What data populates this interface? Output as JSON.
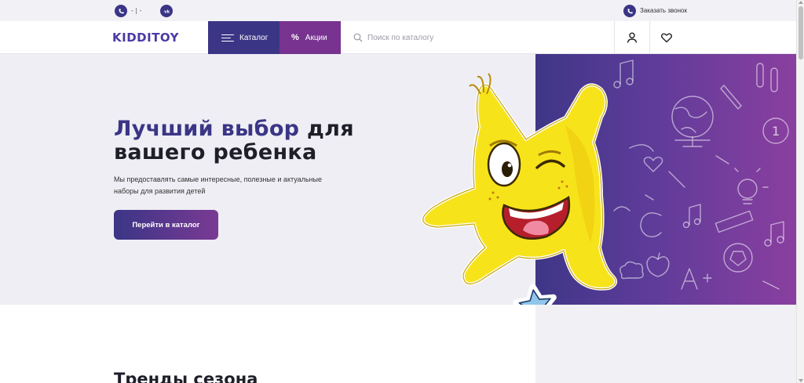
{
  "topbar": {
    "phone_text": "- | -",
    "callback_label": "Заказать звонок",
    "icons": [
      "phone-icon",
      "vk-icon",
      "phone-icon"
    ]
  },
  "header": {
    "logo_text": "KIDDITOY",
    "catalog_label": "Каталог",
    "promo_label": "Акции",
    "promo_icon": "%",
    "search_placeholder": "Поиск по каталогу",
    "icons": [
      "search-icon",
      "user-icon",
      "heart-icon"
    ]
  },
  "hero": {
    "title_accent": "Лучший выбор",
    "title_rest": " для вашего ребенка",
    "subtitle": "Мы предоставлять самые интересные, полезные и актуальные наборы для развития детей",
    "cta_label": "Перейти в каталог"
  },
  "sections": {
    "trends_title": "Тренды сезона"
  },
  "colors": {
    "primary": "#3b3586",
    "promo": "#77338f",
    "art_gradient_start": "#3e3687",
    "art_gradient_end": "#8a3f9f",
    "mascot": "#f7e31a"
  }
}
